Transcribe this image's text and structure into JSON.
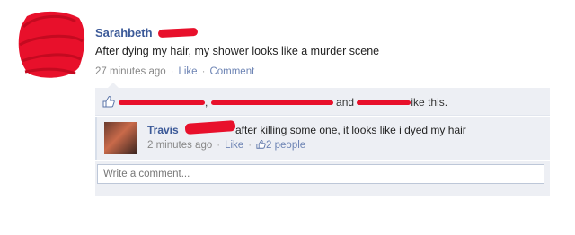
{
  "post": {
    "author": "Sarahbeth",
    "text": "After dying my hair, my shower looks like a murder scene",
    "time": "27 minutes ago",
    "like_label": "Like",
    "comment_label": "Comment"
  },
  "likes": {
    "and_word": "and",
    "suffix": "ike this."
  },
  "comment": {
    "author": "Travis",
    "text": "after killing some one, it looks like i dyed my hair",
    "time": "2 minutes ago",
    "like_label": "Like",
    "like_count": "2 people"
  },
  "composer": {
    "placeholder": "Write a comment..."
  },
  "colors": {
    "link": "#3b5998",
    "meta_link": "#6d84b4",
    "panel_bg": "#edeff4",
    "redaction": "#e8102b"
  },
  "icons": {
    "like": "thumbs-up-icon",
    "small_like": "small-thumbs-up-icon"
  }
}
